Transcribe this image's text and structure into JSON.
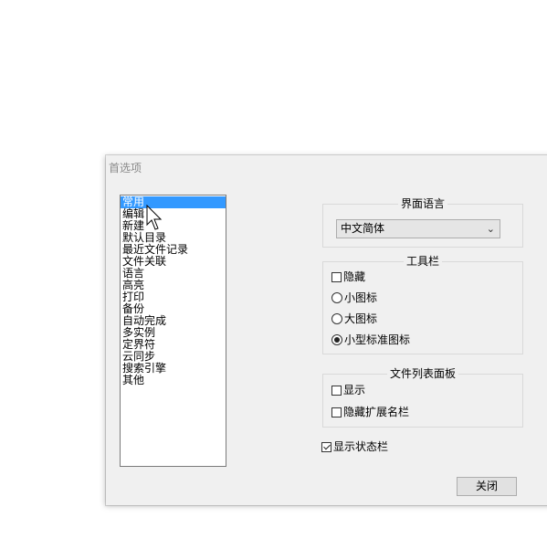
{
  "dialog": {
    "title": "首选项"
  },
  "categories": [
    {
      "label": "常用",
      "selected": true
    },
    {
      "label": "编辑"
    },
    {
      "label": "新建"
    },
    {
      "label": "默认目录"
    },
    {
      "label": "最近文件记录"
    },
    {
      "label": "文件关联"
    },
    {
      "label": "语言"
    },
    {
      "label": "高亮"
    },
    {
      "label": "打印"
    },
    {
      "label": "备份"
    },
    {
      "label": "自动完成"
    },
    {
      "label": "多实例"
    },
    {
      "label": "定界符"
    },
    {
      "label": "云同步"
    },
    {
      "label": "搜索引擎"
    },
    {
      "label": "其他"
    }
  ],
  "ui_language": {
    "title": "界面语言",
    "selected": "中文简体"
  },
  "toolbar": {
    "title": "工具栏",
    "hide_label": "隐藏",
    "hide_checked": false,
    "options": [
      {
        "label": "小图标",
        "checked": false
      },
      {
        "label": "大图标",
        "checked": false
      },
      {
        "label": "小型标准图标",
        "checked": true
      }
    ]
  },
  "doc_list_panel": {
    "title": "文件列表面板",
    "show_label": "显示",
    "show_checked": false,
    "hide_ext_label": "隐藏扩展名栏",
    "hide_ext_checked": false
  },
  "status_bar": {
    "label": "显示状态栏",
    "checked": true
  },
  "close_button": {
    "label": "关闭"
  },
  "colors": {
    "selection": "#3399ff",
    "dialog_bg": "#f0f0f0"
  }
}
